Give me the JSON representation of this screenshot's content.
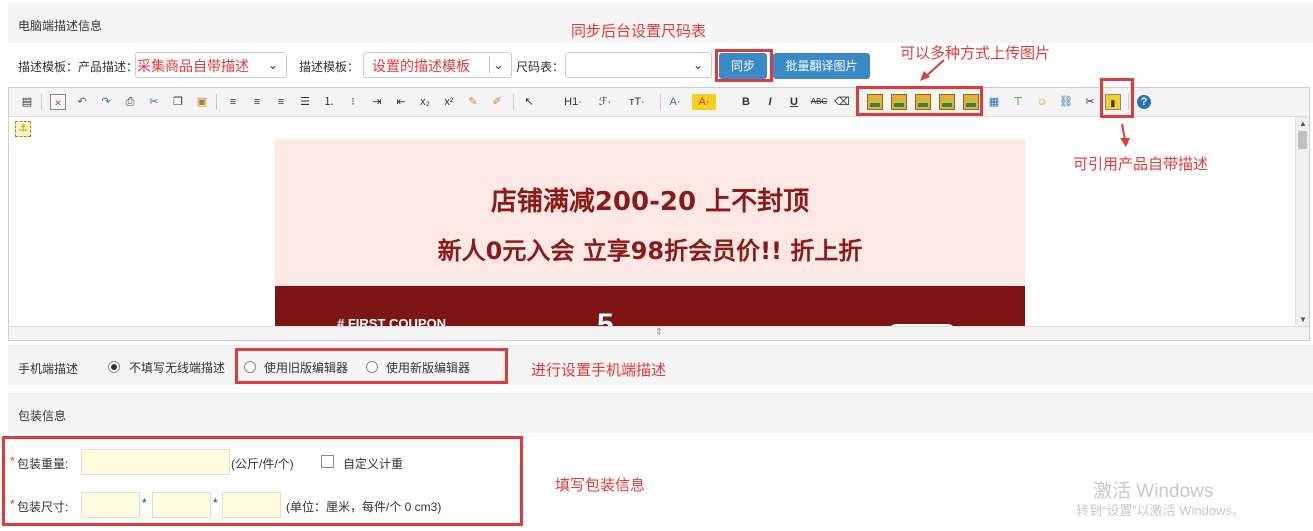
{
  "pc_desc": {
    "section_title": "电脑端描述信息",
    "template_label_1": "描述模板：",
    "product_desc_label": "产品描述：",
    "product_desc_value": "采集商品自带描述",
    "template_label_2": "描述模板：",
    "template_value": "设置的描述模板",
    "size_chart_label": "尺码表：",
    "size_chart_value": "",
    "sync_button": "同步",
    "batch_translate_button": "批量翻译图片"
  },
  "editor": {
    "toolbar_labels": {
      "h1": "H1·",
      "font": "ℱ·",
      "size": "тT·",
      "color": "A·",
      "bg": "A·",
      "bold": "B",
      "italic": "I",
      "underline": "U",
      "strike": "ABC",
      "help": "?"
    },
    "banner_line1": "店铺满减200-20 上不封顶",
    "banner_line2": "新人0元入会 立享98折会员价!! 折上折",
    "banner_coupon": "# FIRST COUPON",
    "banner_five": "5"
  },
  "mobile_desc": {
    "label": "手机端描述",
    "option_none": "不填写无线端描述",
    "option_old": "使用旧版编辑器",
    "option_new": "使用新版编辑器"
  },
  "package": {
    "section_title": "包装信息",
    "weight_label": "包装重量:",
    "weight_unit": "(公斤/件/个)",
    "custom_weight_label": "自定义计重",
    "size_label": "包装尺寸:",
    "size_star": "*",
    "size_unit": "(单位：厘米，每件/个 0 cm3)"
  },
  "annotations": {
    "sync_size_chart": "同步后台设置尺码表",
    "multi_upload": "可以多种方式上传图片",
    "cite_desc": "可引用产品自带描述",
    "mobile_setup": "进行设置手机端描述",
    "package_fill": "填写包装信息"
  },
  "watermark": {
    "line1": "激活 Windows",
    "line2": "转到“设置”以激活 Windows。"
  },
  "colors": {
    "accent_red": "#e03a3a",
    "button_blue": "#3a8ac8",
    "banner_dark": "#7d1515",
    "banner_light": "#fde8e4"
  }
}
